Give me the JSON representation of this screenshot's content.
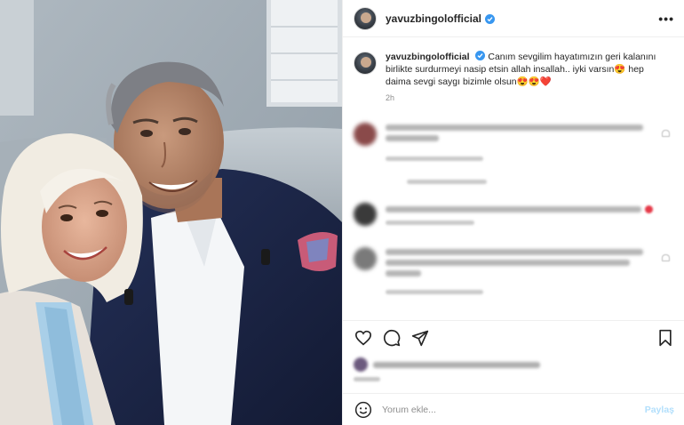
{
  "post": {
    "username": "yavuzbingolofficial",
    "verified": true,
    "more_icon": "•••"
  },
  "caption": {
    "username": "yavuzbingolofficial",
    "text": "Canım sevgilim hayatımızın geri kalanını birlikte surdurmeyi nasip etsin allah insallah.. iyki varsın😍 hep daima sevgi saygı bizimle olsun😍😍❤️",
    "time": "2h"
  },
  "comment_box": {
    "placeholder": "Yorum ekle...",
    "share_label": "Paylaş"
  },
  "colors": {
    "link_blue": "#3897f0",
    "share_disabled": "#b2dffc",
    "text": "#262626",
    "muted": "#8e8e8e"
  },
  "icons": [
    "more-options-icon",
    "verified-badge-icon",
    "heart-icon",
    "comment-icon",
    "share-icon",
    "bookmark-icon",
    "emoji-smile-icon"
  ]
}
